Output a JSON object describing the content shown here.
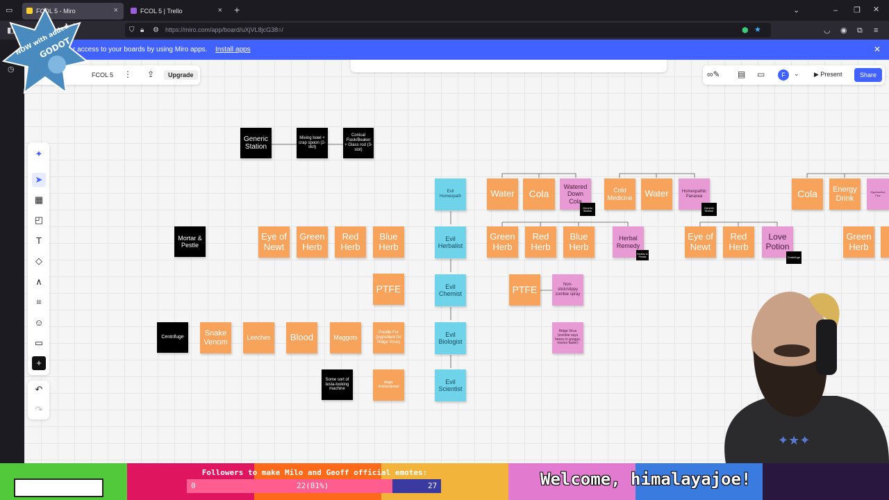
{
  "browser": {
    "tabs": [
      {
        "title": "FCOL 5 - Miro",
        "active": true
      },
      {
        "title": "FCOL 5 | Trello",
        "active": false
      }
    ],
    "new_tab_symbol": "+",
    "url": "https://miro.com/app/board/uXjVL8jcG38=/",
    "url_faded": true
  },
  "overlay_badge": {
    "line1": "NOW with added...",
    "line2": "GODOT"
  },
  "banner": {
    "text": "r access to your boards by using Miro apps.",
    "link": "Install apps",
    "close_icon": "close-icon"
  },
  "miro_header": {
    "board_name": "FCOL 5",
    "upgrade": "Upgrade",
    "present": "Present",
    "share": "Share",
    "avatar_letter": "F"
  },
  "toolbar_icons": [
    "sparkle-icon",
    "cursor-icon",
    "template-icon",
    "sticky-note-icon",
    "text-icon",
    "shapes-icon",
    "pen-icon",
    "frame-icon",
    "emoji-icon",
    "comment-icon",
    "add-icon",
    "undo-icon",
    "redo-icon"
  ],
  "notes": {
    "generic_station": "Generic Station",
    "mixing_bowl": "Mixing bowl + crap spoon (2-slot)",
    "conical_flask": "Conical Flask/Beaker + Glass rod (3-slot)",
    "mortar_pestle": "Mortar & Pestle",
    "eye_of_newt_1": "Eye of Newt",
    "green_herb_1": "Green Herb",
    "red_herb_1": "Red Herb",
    "blue_herb_1": "Blue Herb",
    "ptfe_1": "PTFE",
    "centrifuge": "Centrifuge",
    "snake_venom": "Snake Venom",
    "leeches": "Leeches",
    "blood": "Blood",
    "maggots": "Maggots",
    "poodle_fur": "Poodle Fur (ingredient for Ridge Virus)",
    "tesla_machine": "Some sort of tesla-looking machine",
    "magic_artefact": "Magic Artefact/jewel",
    "evil_homeopath": "Evil Homeopath",
    "evil_herbalist": "Evil Herbalist",
    "evil_chemist": "Evil Chemist",
    "evil_biologist": "Evil Biologist",
    "evil_scientist": "Evil Scientist",
    "water_1": "Water",
    "cola_1": "Cola",
    "watered_down_cola": "Watered Down Cola",
    "green_herb_2": "Green Herb",
    "red_herb_2": "Red Herb",
    "blue_herb_2": "Blue Herb",
    "herbal_remedy": "Herbal Remedy",
    "ptfe_2": "PTFE",
    "zombie_spray": "Non-stick/slippy zombie spray",
    "ridge_virus": "Ridge Virus (zombie says heeey in greggs, moves faster)",
    "cold_medicine": "Cold Medicine",
    "water_2": "Water",
    "homeopathic_panacea": "Homeopathic Panacea",
    "eye_of_newt_2": "Eye of Newt",
    "red_herb_3": "Red Herb",
    "love_potion": "Love Potion",
    "cola_2": "Cola",
    "energy_drink": "Energy Drink",
    "hyperactive": "Hyperactive Fizz",
    "green_herb_3": "Green Herb"
  },
  "tags": {
    "generic_station_1": "Generic Station",
    "generic_station_2": "Generic Station",
    "mortar_tag": "Mortar & Pestle",
    "centrifuge_tag": "Centrifuge"
  },
  "stream_overlay": {
    "goal_label": "Followers to make Milo and Geoff official emotes:",
    "goal_start": "0",
    "goal_current": "22(81%)",
    "goal_target": "27",
    "goal_fraction": 0.81,
    "welcome": "Welcome, himalayajoe!",
    "colors": [
      "#52c93a",
      "#e0155f",
      "#ff6a1a",
      "#f2b43a",
      "#e27ad0",
      "#3a7be0",
      "#2a1740"
    ]
  }
}
